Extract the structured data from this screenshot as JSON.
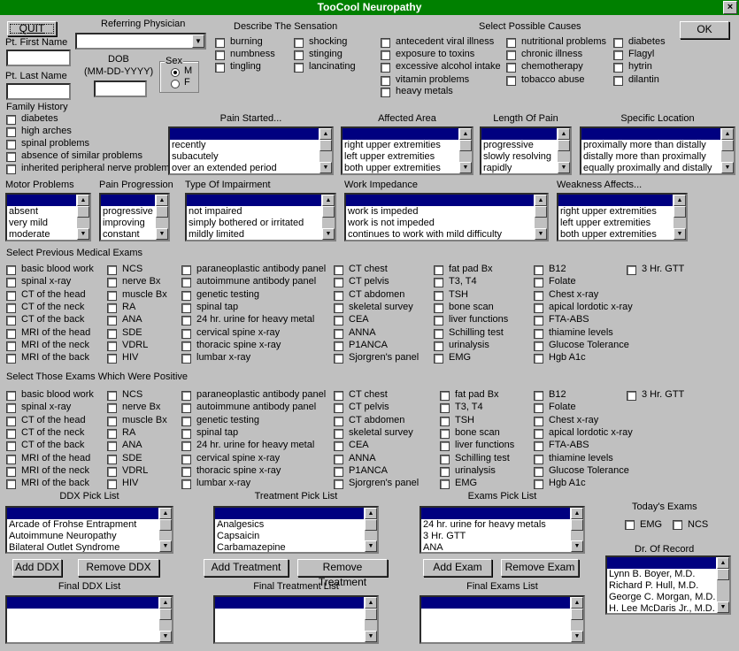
{
  "window": {
    "title": "TooCool Neuropathy",
    "close": "×"
  },
  "buttons": {
    "quit": "QUIT",
    "ok": "OK",
    "add_ddx": "Add DDX",
    "remove_ddx": "Remove DDX",
    "add_treatment": "Add Treatment",
    "remove_treatment": "Remove Treatment",
    "add_exam": "Add Exam",
    "remove_exam": "Remove Exam"
  },
  "patient": {
    "first_name_label": "Pt. First Name",
    "last_name_label": "Pt. Last Name",
    "first_name": "",
    "last_name": "",
    "dob_label1": "DOB",
    "dob_label2": "(MM-DD-YYYY)",
    "dob": "",
    "sex_label": "Sex",
    "sex_m": "M",
    "sex_f": "F",
    "sex_selected": "M"
  },
  "physician": {
    "label": "Referring Physician",
    "value": ""
  },
  "sensation": {
    "label": "Describe The Sensation",
    "items": [
      "burning",
      "numbness",
      "tingling",
      "shocking",
      "stinging",
      "lancinating"
    ]
  },
  "causes": {
    "label": "Select Possible Causes",
    "items": [
      "antecedent viral illness",
      "exposure to toxins",
      "excessive alcohol intake",
      "vitamin problems",
      "heavy metals",
      "nutritional problems",
      "chronic illness",
      "chemotherapy",
      "tobacco abuse",
      "diabetes",
      "Flagyl",
      "hytrin",
      "dilantin"
    ]
  },
  "family": {
    "label": "Family History",
    "items": [
      "diabetes",
      "high arches",
      "spinal problems",
      "absence of similar problems",
      "inherited peripheral nerve problems"
    ]
  },
  "lists1": [
    {
      "label": "Pain Started...",
      "items": [
        "recently",
        "subacutely",
        "over an extended period"
      ]
    },
    {
      "label": "Affected Area",
      "items": [
        "right upper extremities",
        "left upper extremities",
        "both upper extremities"
      ]
    },
    {
      "label": "Length Of Pain",
      "items": [
        "progressive",
        "slowly resolving",
        "rapidly"
      ]
    },
    {
      "label": "Specific Location",
      "items": [
        "proximally more than distally",
        "distally more than proximally",
        "equally proximally and distally"
      ]
    }
  ],
  "lists2": [
    {
      "label": "Motor Problems",
      "items": [
        "absent",
        "very mild",
        "moderate"
      ]
    },
    {
      "label": "Pain Progression",
      "items": [
        "progressive",
        "improving",
        "constant"
      ]
    },
    {
      "label": "Type Of Impairment",
      "items": [
        "not impaired",
        "simply bothered or irritated",
        "mildly limited"
      ]
    },
    {
      "label": "Work Impedance",
      "items": [
        "work is impeded",
        "work is not impeded",
        "continues to work with mild difficulty"
      ]
    },
    {
      "label": "Weakness Affects...",
      "items": [
        "right upper extremities",
        "left upper extremities",
        "both upper extremities"
      ]
    }
  ],
  "prev_exams": {
    "label": "Select Previous Medical Exams"
  },
  "pos_exams": {
    "label": "Select Those Exams Which Were Positive"
  },
  "exam_cols": [
    [
      "basic blood work",
      "spinal x-ray",
      "CT of the head",
      "CT of the neck",
      "CT of the back",
      "MRI of the head",
      "MRI of the neck",
      "MRI of the back"
    ],
    [
      "NCS",
      "nerve Bx",
      "muscle Bx",
      "RA",
      "ANA",
      "SDE",
      "VDRL",
      "HIV"
    ],
    [
      "paraneoplastic antibody panel",
      "autoimmune antibody panel",
      "genetic testing",
      "spinal tap",
      "24 hr. urine for heavy metal",
      "cervical spine x-ray",
      "thoracic spine x-ray",
      "lumbar x-ray"
    ],
    [
      "CT chest",
      "CT pelvis",
      "CT abdomen",
      "skeletal survey",
      "CEA",
      "ANNA",
      "P1ANCA",
      "Sjorgren's panel"
    ],
    [
      "fat pad Bx",
      "T3, T4",
      "TSH",
      "bone scan",
      "liver functions",
      "Schilling test",
      "urinalysis",
      "EMG"
    ],
    [
      "B12",
      "Folate",
      "Chest x-ray",
      "apical lordotic x-ray",
      "FTA-ABS",
      "thiamine levels",
      "Glucose Tolerance",
      "Hgb A1c"
    ],
    [
      "3 Hr. GTT"
    ]
  ],
  "picks": [
    {
      "label": "DDX Pick List",
      "items": [
        "Arcade of Frohse Entrapment",
        "Autoimmune Neuropathy",
        "Bilateral Outlet Syndrome"
      ]
    },
    {
      "label": "Treatment Pick List",
      "items": [
        "Analgesics",
        "Capsaicin",
        "Carbamazepine"
      ]
    },
    {
      "label": "Exams Pick List",
      "items": [
        "24 hr. urine for heavy metals",
        "3 Hr. GTT",
        "ANA"
      ]
    }
  ],
  "finals": [
    {
      "label": "Final DDX List",
      "items": []
    },
    {
      "label": "Final Treatment List",
      "items": []
    },
    {
      "label": "Final Exams List",
      "items": []
    }
  ],
  "today": {
    "label": "Today's Exams",
    "emg": "EMG",
    "ncs": "NCS"
  },
  "doctor": {
    "label": "Dr. Of Record",
    "items": [
      "Lynn B. Boyer, M.D.",
      "Richard P. Hull, M.D.",
      "George C. Morgan, M.D.",
      "H. Lee McDaris Jr., M.D."
    ]
  }
}
